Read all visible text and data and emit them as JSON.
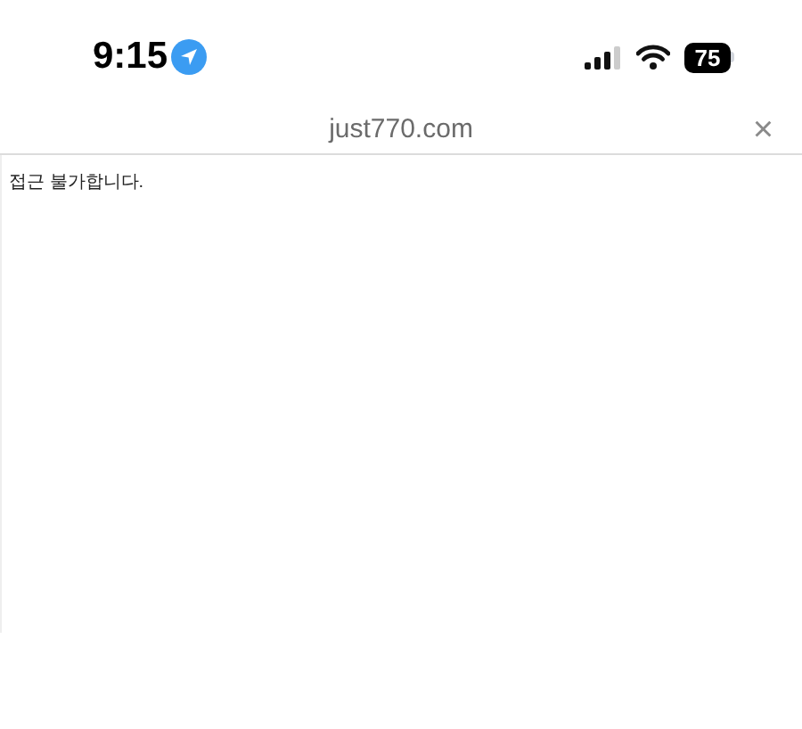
{
  "status_bar": {
    "time": "9:15",
    "battery": "75"
  },
  "address_bar": {
    "url": "just770.com",
    "close": "×"
  },
  "page": {
    "message": "접근 불가합니다."
  }
}
